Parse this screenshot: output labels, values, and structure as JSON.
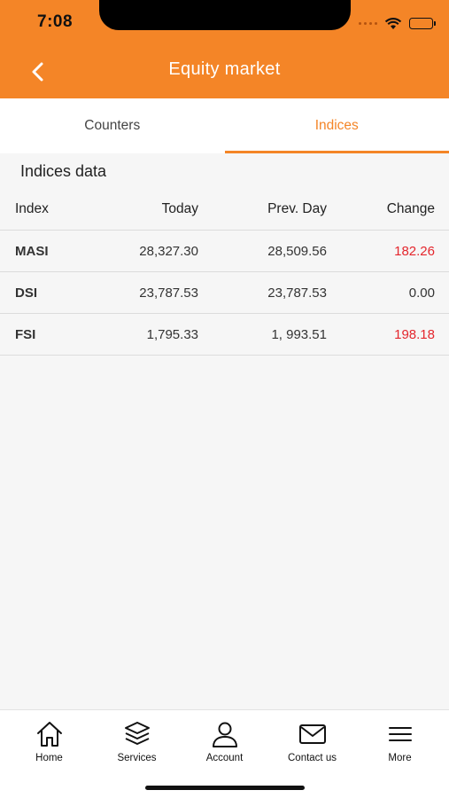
{
  "status_bar": {
    "time": "7:08"
  },
  "header": {
    "title": "Equity market"
  },
  "tabs": [
    {
      "label": "Counters",
      "active": false
    },
    {
      "label": "Indices",
      "active": true
    }
  ],
  "section": {
    "title": "Indices data"
  },
  "table": {
    "columns": [
      "Index",
      "Today",
      "Prev. Day",
      "Change"
    ],
    "rows": [
      {
        "index": "MASI",
        "today": "28,327.30",
        "prev_day": "28,509.56",
        "change": "182.26"
      },
      {
        "index": "DSI",
        "today": "23,787.53",
        "prev_day": "23,787.53",
        "change": "0.00"
      },
      {
        "index": "FSI",
        "today": "1,795.33",
        "prev_day": "1, 993.51",
        "change": "198.18"
      }
    ]
  },
  "bottom_nav": [
    {
      "label": "Home",
      "icon": "home-icon"
    },
    {
      "label": "Services",
      "icon": "layers-icon"
    },
    {
      "label": "Account",
      "icon": "user-icon"
    },
    {
      "label": "Contact us",
      "icon": "mail-icon"
    },
    {
      "label": "More",
      "icon": "menu-icon"
    }
  ],
  "colors": {
    "accent": "#F48527",
    "negative": "#E4262D",
    "background": "#F6F6F6"
  }
}
